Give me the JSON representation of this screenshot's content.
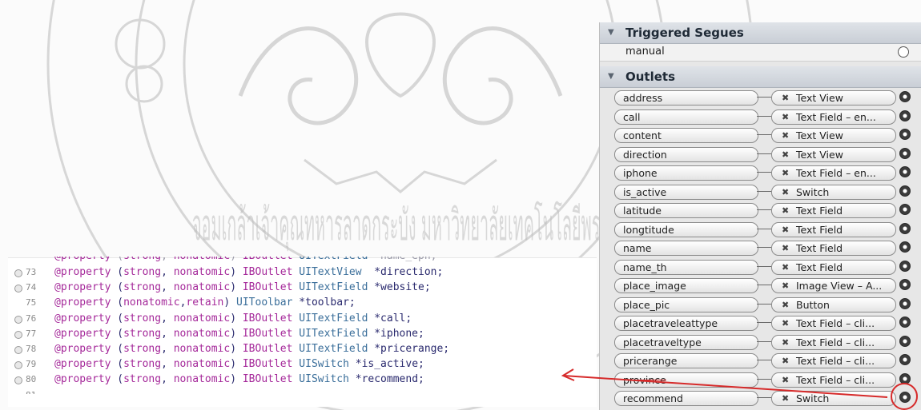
{
  "seal": {
    "text": "จอมเกล้าเจ้าคุณทหารลาดกระบัง มหาวิทยาลัยเทคโนโลยีพระ"
  },
  "code": {
    "top_partial": "@property (strong, nonatomic) IBOutlet UITextField *name_eph;",
    "lines": [
      {
        "num": "73",
        "dot": true,
        "text": "@property (strong, nonatomic) IBOutlet UITextView  *direction;"
      },
      {
        "num": "74",
        "dot": true,
        "text": "@property (strong, nonatomic) IBOutlet UITextField *website;"
      },
      {
        "num": "75",
        "dot": false,
        "text": "@property (nonatomic,retain) UIToolbar *toolbar;"
      },
      {
        "num": "76",
        "dot": true,
        "text": "@property (strong, nonatomic) IBOutlet UITextField *call;"
      },
      {
        "num": "77",
        "dot": true,
        "text": "@property (strong, nonatomic) IBOutlet UITextField *iphone;"
      },
      {
        "num": "78",
        "dot": true,
        "text": "@property (strong, nonatomic) IBOutlet UITextField *pricerange;"
      },
      {
        "num": "79",
        "dot": true,
        "text": "@property (strong, nonatomic) IBOutlet UISwitch *is_active;"
      },
      {
        "num": "80",
        "dot": true,
        "text": "@property (strong, nonatomic) IBOutlet UISwitch *recommend;"
      },
      {
        "num": "81",
        "dot": false,
        "text": ""
      }
    ]
  },
  "panel": {
    "triggered_segues": {
      "header": "Triggered Segues",
      "items": [
        {
          "label": "manual"
        }
      ]
    },
    "outlets": {
      "header": "Outlets",
      "rows": [
        {
          "name": "address",
          "target": "Text View"
        },
        {
          "name": "call",
          "target": "Text Field – en..."
        },
        {
          "name": "content",
          "target": "Text View"
        },
        {
          "name": "direction",
          "target": "Text View"
        },
        {
          "name": "iphone",
          "target": "Text Field – en..."
        },
        {
          "name": "is_active",
          "target": "Switch"
        },
        {
          "name": "latitude",
          "target": "Text Field"
        },
        {
          "name": "longtitude",
          "target": "Text Field"
        },
        {
          "name": "name",
          "target": "Text Field"
        },
        {
          "name": "name_th",
          "target": "Text Field"
        },
        {
          "name": "place_image",
          "target": "Image View – A..."
        },
        {
          "name": "place_pic",
          "target": "Button"
        },
        {
          "name": "placetraveleattype",
          "target": "Text Field – cli..."
        },
        {
          "name": "placetraveltype",
          "target": "Text Field – cli..."
        },
        {
          "name": "pricerange",
          "target": "Text Field – cli..."
        },
        {
          "name": "province",
          "target": "Text Field – cli..."
        },
        {
          "name": "recommend",
          "target": "Switch"
        }
      ]
    }
  },
  "colors": {
    "annotation_red": "#d62a2a",
    "keyword": "#a5299a",
    "text": "#2a2a6e"
  },
  "icons": {
    "disclosure": "disclosure-triangle-icon",
    "remove": "remove-x-icon",
    "well": "connection-well-icon"
  }
}
